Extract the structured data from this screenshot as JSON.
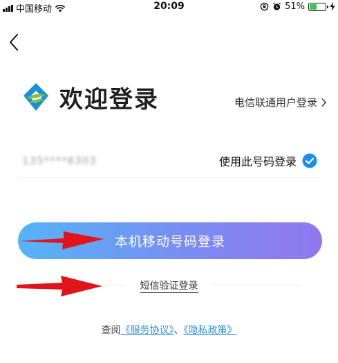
{
  "status_bar": {
    "carrier": "中国移动",
    "time": "20:09",
    "battery_percent": "51%",
    "battery_level": 0.51,
    "icons": [
      "signal-icon",
      "wifi-icon",
      "lock-rotation-icon",
      "alarm-icon",
      "battery-icon",
      "charging-icon"
    ]
  },
  "nav": {
    "back_icon": "chevron-left-icon"
  },
  "header": {
    "logo_icon": "china-mobile-logo",
    "title": "欢迎登录",
    "other_operator_link": "电信联通用户登录"
  },
  "phone": {
    "masked_number": "135****6303",
    "use_number_label": "使用此号码登录",
    "checked": true
  },
  "main_button": {
    "label": "本机移动号码登录"
  },
  "sms_login": {
    "label": "短信验证登录"
  },
  "agreement": {
    "prefix": "查阅",
    "service_link": "《服务协议》",
    "separator": "、",
    "privacy_link": "《隐私政策》"
  },
  "colors": {
    "button_gradient_start": "#55b4f6",
    "button_gradient_end": "#9277ef",
    "link": "#2a8fe0",
    "check": "#1f8cf0",
    "arrow": "#e0151b"
  }
}
